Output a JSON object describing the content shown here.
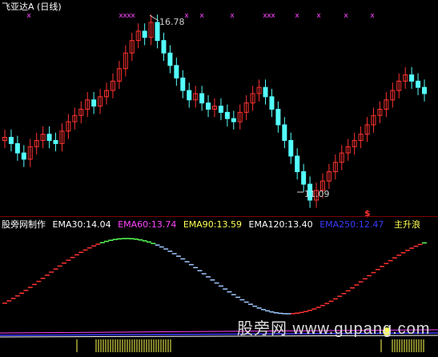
{
  "chart": {
    "title": "飞亚达A (日线)",
    "high_label": "16.78",
    "low_label": "11.09",
    "dollar_mark": "$",
    "colors": {
      "up": "#ff3232",
      "down": "#54ffff",
      "marker": "#ff44ff",
      "bg": "#000000"
    }
  },
  "indicator": {
    "name": "股旁网制作",
    "values": [
      {
        "label": "EMA30:14.04",
        "color": "#ffffff"
      },
      {
        "label": "EMA60:13.74",
        "color": "#ff44ff"
      },
      {
        "label": "EMA90:13.59",
        "color": "#ffff55"
      },
      {
        "label": "EMA120:13.40",
        "color": "#ffffff"
      },
      {
        "label": "EMA250:12.47",
        "color": "#3c3cff"
      }
    ],
    "signal": "主升浪"
  },
  "watermark": "股旁网 www.gupang.com",
  "chart_data": {
    "type": "candlestick",
    "series": [
      {
        "name": "飞亚达A",
        "approx_close": [
          13.1,
          12.9,
          12.6,
          12.4,
          12.8,
          13.0,
          13.2,
          13.0,
          12.9,
          13.3,
          13.6,
          13.8,
          14.0,
          14.3,
          14.1,
          14.4,
          14.6,
          14.9,
          15.3,
          15.8,
          16.2,
          16.5,
          16.3,
          16.78,
          16.2,
          15.8,
          15.4,
          15.0,
          14.6,
          14.3,
          14.5,
          14.2,
          14.0,
          14.1,
          13.9,
          13.7,
          13.6,
          13.9,
          14.2,
          14.5,
          14.7,
          14.4,
          14.0,
          13.5,
          13.0,
          12.5,
          12.0,
          11.6,
          11.09,
          11.4,
          11.7,
          12.0,
          12.3,
          12.6,
          12.8,
          13.0,
          13.2,
          13.5,
          13.8,
          14.0,
          14.3,
          14.6,
          14.9,
          15.1,
          14.9,
          14.7,
          14.5
        ]
      }
    ],
    "annotations": [
      "16.78",
      "11.09"
    ]
  }
}
